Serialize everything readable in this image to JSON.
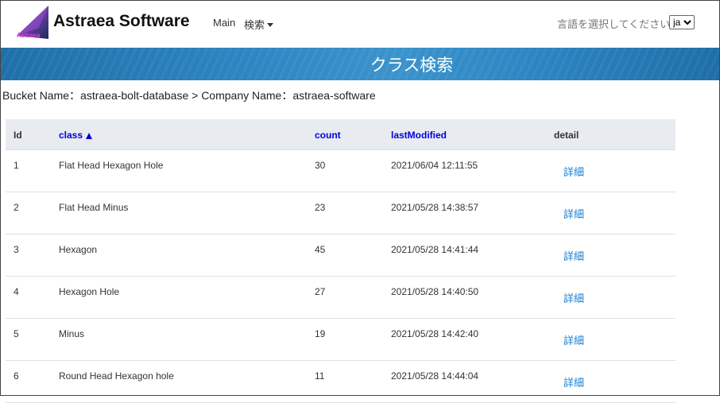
{
  "navbar": {
    "brand": "Astraea Software",
    "logo_text": "Astraea",
    "menu": [
      {
        "label": "Main"
      },
      {
        "label": "検索"
      }
    ],
    "language_label": "言語を選択してください。",
    "language_value": "ja"
  },
  "banner": {
    "title": "クラス検索"
  },
  "breadcrumb": "Bucket Name：astraea-bolt-database > Company Name：astraea-software",
  "table": {
    "headers": {
      "id": "Id",
      "class": "class",
      "count": "count",
      "last_modified": "lastModified",
      "detail": "detail"
    },
    "rows": [
      {
        "id": "1",
        "class": "Flat Head Hexagon Hole",
        "count": "30",
        "last_modified": "2021/06/04 12:11:55",
        "detail": "詳細"
      },
      {
        "id": "2",
        "class": "Flat Head Minus",
        "count": "23",
        "last_modified": "2021/05/28 14:38:57",
        "detail": "詳細"
      },
      {
        "id": "3",
        "class": "Hexagon",
        "count": "45",
        "last_modified": "2021/05/28 14:41:44",
        "detail": "詳細"
      },
      {
        "id": "4",
        "class": "Hexagon Hole",
        "count": "27",
        "last_modified": "2021/05/28 14:40:50",
        "detail": "詳細"
      },
      {
        "id": "5",
        "class": "Minus",
        "count": "19",
        "last_modified": "2021/05/28 14:42:40",
        "detail": "詳細"
      },
      {
        "id": "6",
        "class": "Round Head Hexagon hole",
        "count": "11",
        "last_modified": "2021/05/28 14:44:04",
        "detail": "詳細"
      }
    ]
  },
  "colors": {
    "link": "#1a7fd4",
    "sort_header": "#0000dd",
    "banner": "#2d86c2"
  }
}
